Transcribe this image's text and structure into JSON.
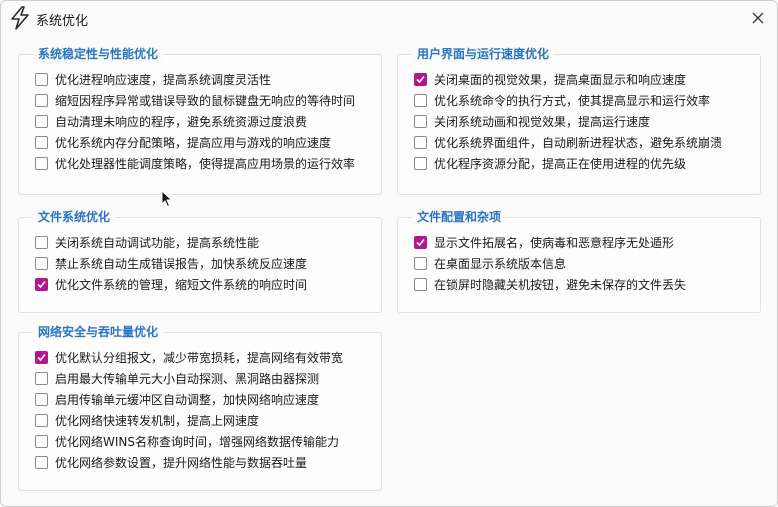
{
  "window": {
    "title": "系统优化",
    "icon": "lightning-icon",
    "close_icon": "close-icon"
  },
  "groups": [
    {
      "title": "系统稳定性与性能优化",
      "options": [
        {
          "label": "优化进程响应速度，提高系统调度灵活性",
          "checked": false
        },
        {
          "label": "缩短因程序异常或错误导致的鼠标键盘无响应的等待时间",
          "checked": false
        },
        {
          "label": "自动清理未响应的程序，避免系统资源过度浪费",
          "checked": false
        },
        {
          "label": "优化系统内存分配策略，提高应用与游戏的响应速度",
          "checked": false
        },
        {
          "label": "优化处理器性能调度策略，使得提高应用场景的运行效率",
          "checked": false
        }
      ]
    },
    {
      "title": "用户界面与运行速度优化",
      "options": [
        {
          "label": "关闭桌面的视觉效果，提高桌面显示和响应速度",
          "checked": true
        },
        {
          "label": "优化系统命令的执行方式，使其提高显示和运行效率",
          "checked": false
        },
        {
          "label": "关闭系统动画和视觉效果，提高运行速度",
          "checked": false
        },
        {
          "label": "优化系统界面组件，自动刷新进程状态，避免系统崩溃",
          "checked": false
        },
        {
          "label": "优化程序资源分配，提高正在使用进程的优先级",
          "checked": false
        }
      ]
    },
    {
      "title": "文件系统优化",
      "options": [
        {
          "label": "关闭系统自动调试功能，提高系统性能",
          "checked": false
        },
        {
          "label": "禁止系统自动生成错误报告，加快系统反应速度",
          "checked": false
        },
        {
          "label": "优化文件系统的管理，缩短文件系统的响应时间",
          "checked": true
        }
      ]
    },
    {
      "title": "文件配置和杂项",
      "options": [
        {
          "label": "显示文件拓展名，使病毒和恶意程序无处遁形",
          "checked": true
        },
        {
          "label": "在桌面显示系统版本信息",
          "checked": false
        },
        {
          "label": "在锁屏时隐藏关机按钮，避免未保存的文件丢失",
          "checked": false
        }
      ]
    },
    {
      "title": "网络安全与吞吐量优化",
      "options": [
        {
          "label": "优化默认分组报文，减少带宽损耗，提高网络有效带宽",
          "checked": true
        },
        {
          "label": "启用最大传输单元大小自动探测、黑洞路由器探测",
          "checked": false
        },
        {
          "label": "启用传输单元缓冲区自动调整，加快网络响应速度",
          "checked": false
        },
        {
          "label": "优化网络快速转发机制，提高上网速度",
          "checked": false
        },
        {
          "label": "优化网络WINS名称查询时间，增强网络数据传输能力",
          "checked": false
        },
        {
          "label": "优化网络参数设置，提升网络性能与数据吞吐量",
          "checked": false
        }
      ]
    }
  ],
  "colors": {
    "accent_title": "#2a74c5",
    "checkbox_checked": "#b4168d"
  }
}
